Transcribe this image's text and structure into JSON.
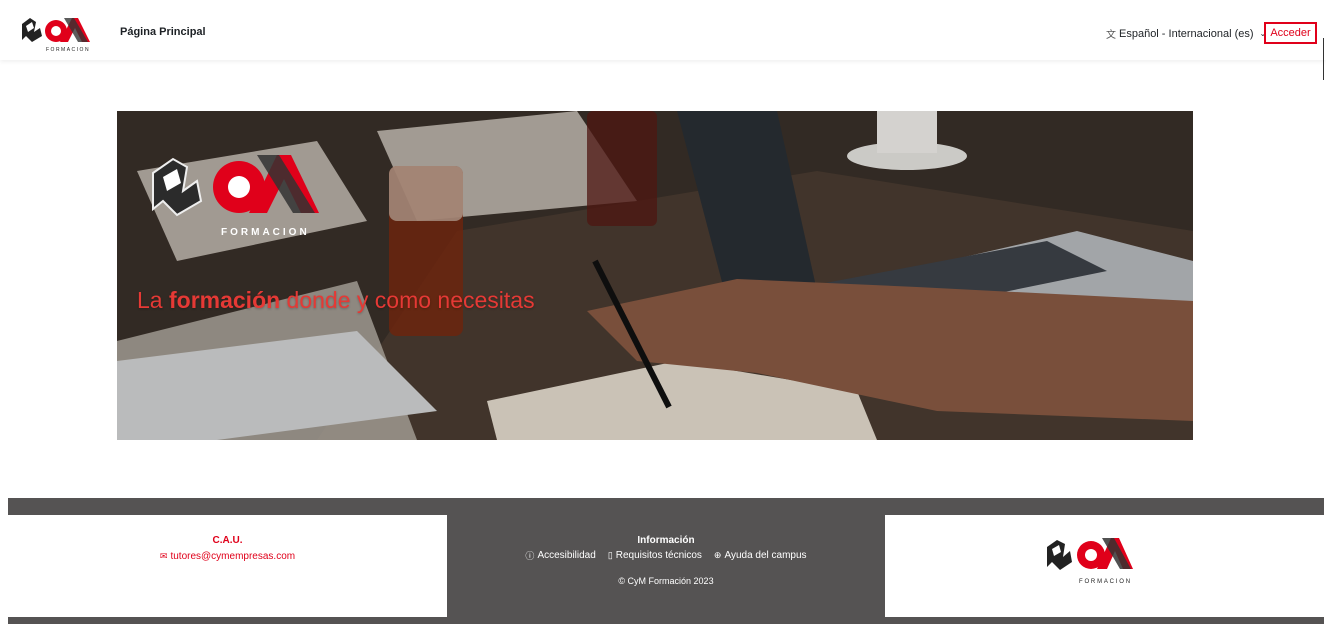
{
  "header": {
    "logo_text": "FORMACION",
    "home_link": "Página Principal",
    "language": "Español - Internacional (es)",
    "login": "Acceder"
  },
  "hero": {
    "logo_text": "FORMACION",
    "tagline_pre": "La ",
    "tagline_bold": "formación",
    "tagline_post": " donde y como necesitas",
    "colors": {
      "accent": "#e53935"
    }
  },
  "footer": {
    "cau": {
      "title": "C.A.U.",
      "email": "tutores@cymempresas.com",
      "icon": "envelope-icon"
    },
    "info": {
      "title": "Información",
      "links": [
        {
          "label": "Accesibilidad",
          "icon": "info-circle-icon"
        },
        {
          "label": "Requisitos técnicos",
          "icon": "document-icon"
        },
        {
          "label": "Ayuda del campus",
          "icon": "life-ring-icon"
        }
      ],
      "copyright": "© CyM Formación 2023"
    },
    "logo_text": "FORMACION"
  },
  "colors": {
    "brand_red": "#e0001a",
    "footer_bg": "#555353"
  }
}
